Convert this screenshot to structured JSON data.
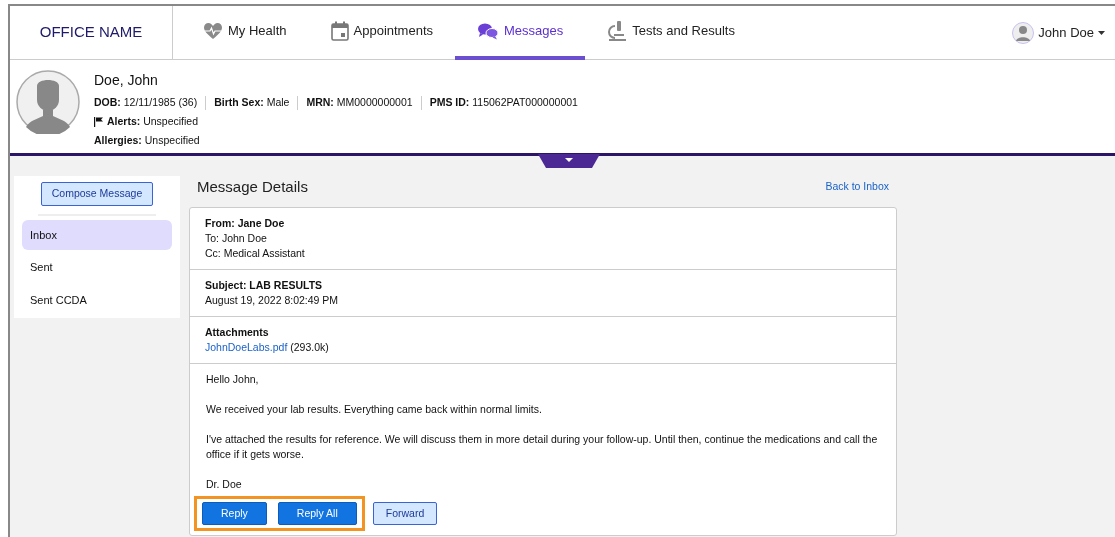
{
  "brand": "OFFICE NAME",
  "nav": {
    "tabs": [
      {
        "label": "My Health",
        "selected": false
      },
      {
        "label": "Appointments",
        "selected": false
      },
      {
        "label": "Messages",
        "selected": true
      },
      {
        "label": "Tests and Results",
        "selected": false
      }
    ],
    "user": "John Doe"
  },
  "patient": {
    "name": "Doe, John",
    "fields": [
      "**DOB:** 12/11/1985 (36)",
      "**Birth Sex:** Male",
      "**MRN:** MM0000000001",
      "**PMS ID:** 115062PAT000000001"
    ],
    "alerts": "**Alerts:** Unspecified",
    "allergies": "**Allergies:** Unspecified"
  },
  "sidebar": {
    "compose": "Compose Message",
    "items": [
      {
        "label": "Inbox",
        "selected": true
      },
      {
        "label": "Sent",
        "selected": false
      },
      {
        "label": "Sent CCDA",
        "selected": false
      }
    ]
  },
  "message": {
    "title": "Message Details",
    "back_link": "Back to Inbox",
    "from": "From: Jane Doe",
    "to": "To: John Doe",
    "cc": "Cc: Medical Assistant",
    "subject": "Subject: LAB RESULTS",
    "date": "August 19, 2022 8:02:49 PM",
    "attachments_label": "Attachments",
    "attachment": {
      "name": "JohnDoeLabs.pdf",
      "size": "(293.0k)"
    },
    "body": [
      "Hello John,",
      "We received your lab results. Everything came back within normal limits.",
      "I've attached the results for reference. We will discuss them in more detail during your follow-up. Until then, continue the medications and call the office if it gets worse.",
      "Dr. Doe"
    ],
    "buttons": [
      {
        "label": "Reply",
        "kind": "primary",
        "highlighted": true
      },
      {
        "label": "Reply All",
        "kind": "primary",
        "highlighted": true
      },
      {
        "label": "Forward",
        "kind": "outline",
        "highlighted": false
      }
    ]
  }
}
